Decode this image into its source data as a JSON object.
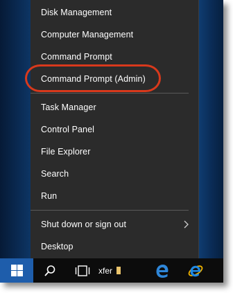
{
  "menu": {
    "items": [
      {
        "label": "Disk Management"
      },
      {
        "label": "Computer Management"
      },
      {
        "label": "Command Prompt"
      },
      {
        "label": "Command Prompt (Admin)"
      },
      {
        "label": "Task Manager"
      },
      {
        "label": "Control Panel"
      },
      {
        "label": "File Explorer"
      },
      {
        "label": "Search"
      },
      {
        "label": "Run"
      },
      {
        "label": "Shut down or sign out"
      },
      {
        "label": "Desktop"
      }
    ]
  },
  "taskbar": {
    "start_icon": "windows-logo-icon",
    "search_icon": "search-icon",
    "task_view_icon": "task-view-icon",
    "folder_label": "xfer",
    "edge_icon": "edge-icon",
    "ie_icon": "internet-explorer-icon"
  },
  "colors": {
    "menu_bg": "#2b2b2b",
    "highlight_ring": "#d9391c",
    "start_button": "#1e5dab"
  }
}
